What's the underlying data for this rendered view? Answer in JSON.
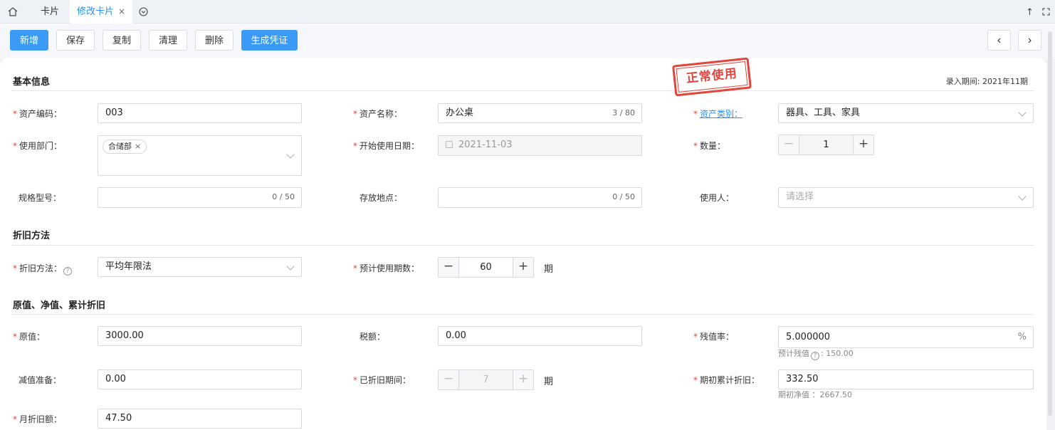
{
  "tabs": {
    "card_label": "卡片",
    "edit_label": "修改卡片",
    "close": "×",
    "more_icon": "chevron-circle-icon"
  },
  "toolbar": {
    "add": "新增",
    "save": "保存",
    "copy": "复制",
    "clear": "清理",
    "delete": "删除",
    "voucher": "生成凭证",
    "prev": "‹",
    "next": "›",
    "up_icon": "↑"
  },
  "stamp": "正常使用",
  "basic": {
    "title": "基本信息",
    "entry_period": "录入期间: 2021年11期",
    "asset_code_label": "资产编码：",
    "asset_code": "003",
    "asset_name_label": "资产名称：",
    "asset_name": "办公桌",
    "asset_name_count": "3 / 80",
    "asset_category_label": "资产类别：",
    "asset_category": "器具、工具、家具",
    "dept_label": "使用部门：",
    "dept_tag": "合储部",
    "start_date_label": "开始使用日期：",
    "start_date": "2021-11-03",
    "qty_label": "数量：",
    "qty": "1",
    "spec_label": "规格型号：",
    "spec_count": "0 / 50",
    "location_label": "存放地点：",
    "location_count": "0 / 50",
    "user_label": "使用人：",
    "user_placeholder": "请选择"
  },
  "depreciation": {
    "title": "折旧方法",
    "method_label": "折旧方法：",
    "method": "平均年限法",
    "periods_label": "预计使用期数：",
    "periods": "60",
    "period_unit": "期"
  },
  "value": {
    "title": "原值、净值、累计折旧",
    "original_label": "原值：",
    "original": "3000.00",
    "tax_label": "税额：",
    "tax": "0.00",
    "residual_rate_label": "残值率：",
    "residual_rate": "5.000000",
    "percent": "%",
    "residual_hint_prefix": "预计残值",
    "residual_hint_value": ": 150.00",
    "impairment_label": "减值准备：",
    "impairment": "0.00",
    "depreciated_label": "已折旧期间：",
    "depreciated": "7",
    "depreciated_unit": "期",
    "opening_acc_label": "期初累计折旧：",
    "opening_acc": "332.50",
    "opening_net_hint": "期初净值 ：2667.50",
    "monthly_label": "月折旧额：",
    "monthly": "47.50"
  },
  "colors": {
    "primary": "#3a9af5",
    "required": "#e0463e",
    "stamp": "#e0463e"
  }
}
